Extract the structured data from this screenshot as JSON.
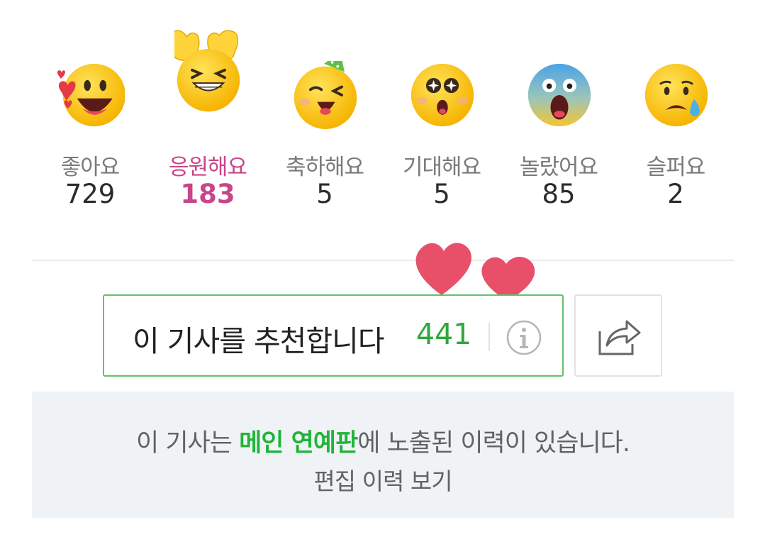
{
  "reactions": [
    {
      "label": "좋아요",
      "count": "729",
      "icon": "heart-eyes-face-icon"
    },
    {
      "label": "응원해요",
      "count": "183",
      "icon": "grinning-squint-face-icon",
      "selected": true
    },
    {
      "label": "축하해요",
      "count": "5",
      "icon": "party-face-icon"
    },
    {
      "label": "기대해요",
      "count": "5",
      "icon": "sparkle-eyes-face-icon"
    },
    {
      "label": "놀랐어요",
      "count": "85",
      "icon": "screaming-face-icon"
    },
    {
      "label": "슬퍼요",
      "count": "2",
      "icon": "crying-face-icon"
    }
  ],
  "recommend": {
    "label": "이 기사를 추천합니다",
    "count": "441",
    "info_icon": "info-icon"
  },
  "share": {
    "icon": "share-icon"
  },
  "notice": {
    "prefix": "이 기사는 ",
    "highlight": "메인 연예판",
    "suffix": "에 노출된 이력이 있습니다.",
    "link": "편집 이력 보기"
  },
  "colors": {
    "selected": "#c9458a",
    "recommend_border": "#62c26c",
    "recommend_count": "#2ea73b",
    "highlight": "#21b43a",
    "notice_bg": "#f0f3f5"
  }
}
